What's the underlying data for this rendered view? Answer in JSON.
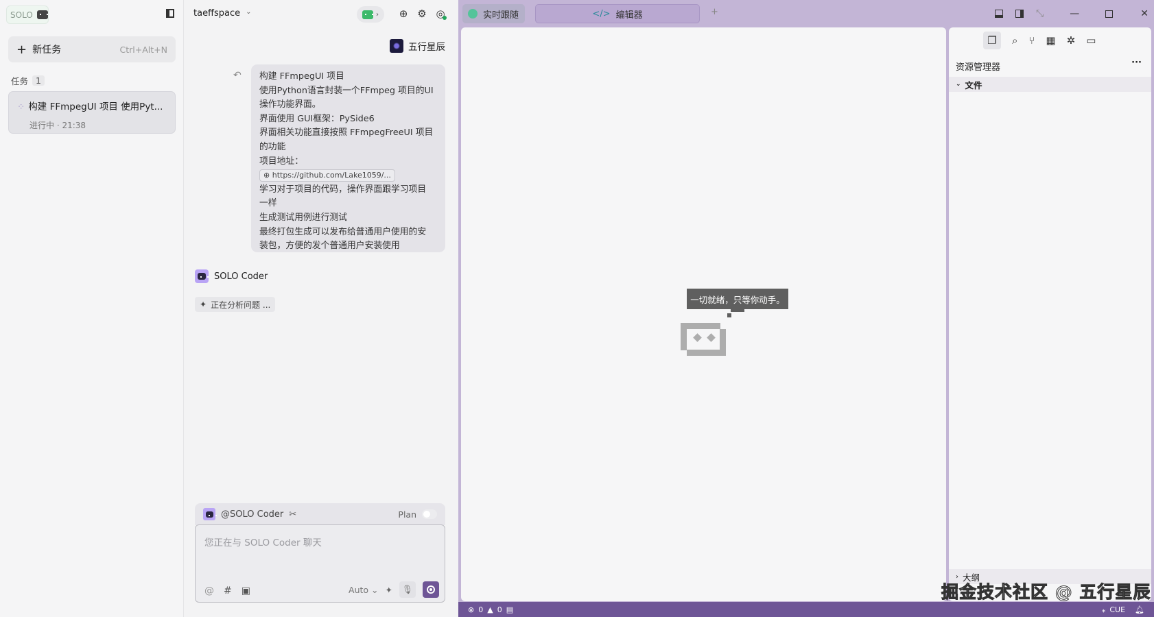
{
  "sidebar": {
    "logo": "SOLO",
    "new_task": "新任务",
    "new_task_shortcut": "Ctrl+Alt+N",
    "tasks_label": "任务",
    "tasks_count": "1",
    "tasks": [
      {
        "title": "构建 FFmpegUI 项目 使用Pyt...",
        "status": "进行中 · 21:38"
      }
    ]
  },
  "chat": {
    "workspace": "taeffspace",
    "user_name": "五行星辰",
    "message_lines": [
      "构建 FFmpegUI 项目",
      "使用Python语言封装一个FFmpeg 项目的UI",
      "操作功能界面。",
      "界面使用 GUI框架：PySide6",
      "界面相关功能直接按照  FFmpegFreeUI 项目",
      "的功能",
      "项目地址："
    ],
    "link": "https://github.com/Lake1059/...",
    "message_lines_2": [
      "学习对于项目的代码，操作界面跟学习项目",
      "一样",
      "生成测试用例进行测试",
      "最终打包生成可以发布给普通用户使用的安",
      "装包，方便的发个普通用户安装使用"
    ],
    "agent_name": "SOLO Coder",
    "agent_status": "正在分析问题 ...",
    "input": {
      "agent": "@SOLO Coder",
      "plan": "Plan",
      "placeholder": "您正在与 SOLO Coder 聊天",
      "model": "Auto"
    }
  },
  "tabs": [
    {
      "label": "实时跟随"
    },
    {
      "label": "编辑器"
    }
  ],
  "editor": {
    "tooltip": "一切就绪，只等你动手。"
  },
  "explorer": {
    "title": "资源管理器",
    "section_files": "文件",
    "section_outline": "大纲"
  },
  "status": {
    "errors": "0",
    "warnings": "0",
    "cue": "CUE"
  },
  "watermark": "掘金技术社区 @ 五行星辰",
  "colors": {
    "accent": "#6e5596",
    "frame": "#c3b5d6",
    "agent_icon": "#b9a4f5"
  }
}
